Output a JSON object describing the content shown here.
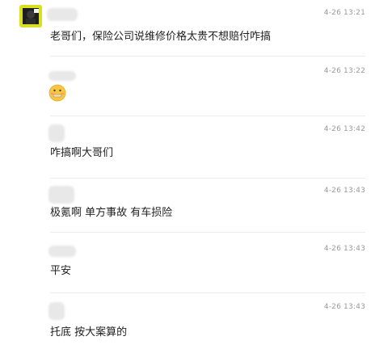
{
  "comments": [
    {
      "time": "4-26 13:21",
      "text": "老哥们，保险公司说维修价格太贵不想赔付咋搞",
      "avatar_icon": "dark-avatar-icon"
    },
    {
      "time": "4-26 13:22",
      "text": "",
      "emoji_icon": "zipper-mouth-face-emoji-icon"
    },
    {
      "time": "4-26 13:42",
      "text": "咋搞啊大哥们"
    },
    {
      "time": "4-26 13:43",
      "text": "极氪啊 单方事故 有车损险"
    },
    {
      "time": "4-26 13:43",
      "text": "平安"
    },
    {
      "time": "4-26 13:43",
      "text": "托底 按大案算的"
    }
  ],
  "colors": {
    "time": "#9a9a9a",
    "divider": "#ececec",
    "blur": "#e8e8e8",
    "avatar_bg": "#d9e021"
  }
}
